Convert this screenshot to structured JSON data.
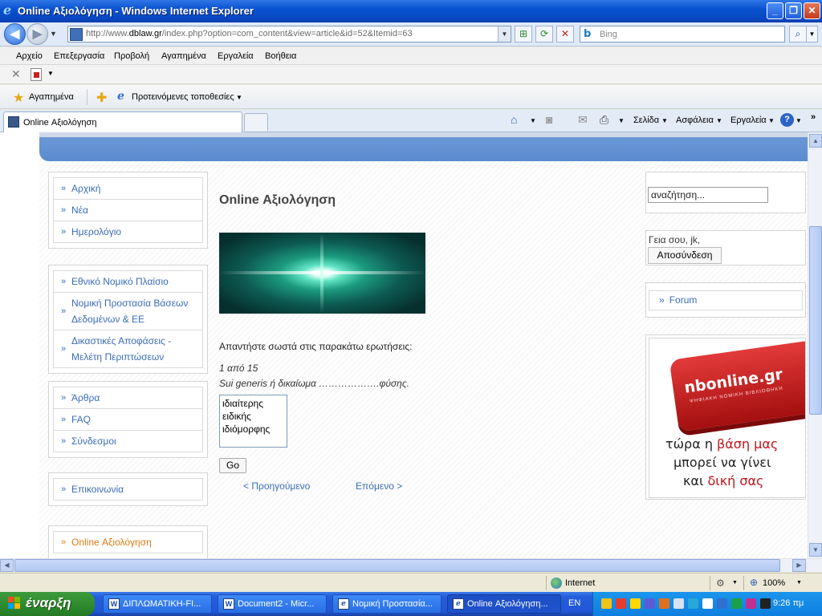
{
  "window": {
    "title": "Online Αξιολόγηση - Windows Internet Explorer"
  },
  "address": {
    "url_prefix": "http://www.",
    "url_domain": "dblaw.gr",
    "url_rest": "/index.php?option=com_content&view=article&id=52&Itemid=63",
    "search_placeholder": "Bing"
  },
  "menu": [
    "Αρχείο",
    "Επεξεργασία",
    "Προβολή",
    "Αγαπημένα",
    "Εργαλεία",
    "Βοήθεια"
  ],
  "favorites": {
    "favorites_label": "Αγαπημένα",
    "suggested_label": "Προτεινόμενες τοποθεσίες"
  },
  "tab": {
    "title": "Online Αξιολόγηση",
    "tools": [
      "Σελίδα",
      "Ασφάλεια",
      "Εργαλεία"
    ]
  },
  "sidebar": {
    "box1": [
      "Αρχική",
      "Νέα",
      "Ημερολόγιο"
    ],
    "box2": [
      "Εθνικό Νομικό Πλαίσιο",
      "Νομική Προστασία Βάσεων Δεδομένων & ΕΕ",
      "Δικαστικές Αποφάσεις - Μελέτη Περιπτώσεων"
    ],
    "box3": [
      "Άρθρα",
      "FAQ",
      "Σύνδεσμοι"
    ],
    "box4": [
      "Επικοινωνία"
    ],
    "box5": [
      "Online Αξιολόγηση"
    ]
  },
  "main": {
    "title": "Online Αξιολόγηση",
    "instruction": "Απαντήστε σωστά στις παρακάτω ερωτήσεις:",
    "question_number": "1 από 15",
    "question_text": "Sui generis ή δικαίωμα ……………….φύσης.",
    "answers": [
      "ιδιαίτερης",
      "ειδικής",
      "ιδιόμορφης"
    ],
    "go_label": "Go",
    "prev_label": "< Προηγούμενο",
    "next_label": "Επόμενο >"
  },
  "right": {
    "search_value": "αναζήτηση...",
    "greeting": "Γεια σου, jk,",
    "logout_label": "Αποσύνδεση",
    "forum_label": "Forum",
    "ad": {
      "brand": "nbonline.gr",
      "tagline": "ΨΗΦΙΑΚΗ ΝΟΜΙΚΗ ΒΙΒΛΙΟΘΗΚΗ",
      "line1_a": "τώρα η ",
      "line1_b": "βάση μας",
      "line2": "μπορεί να γίνει",
      "line3_a": "και ",
      "line3_b": "δική σας"
    }
  },
  "status": {
    "zone": "Internet",
    "zoom": "100%"
  },
  "taskbar": {
    "start_label": "έναρξη",
    "tasks": [
      "ΔΙΠΛΩΜΑΤΙΚΗ-FI...",
      "Document2 - Micr...",
      "Νομική Προστασία...",
      "Online Αξιολόγηση..."
    ],
    "language": "EN",
    "clock": "9:26 πμ"
  }
}
